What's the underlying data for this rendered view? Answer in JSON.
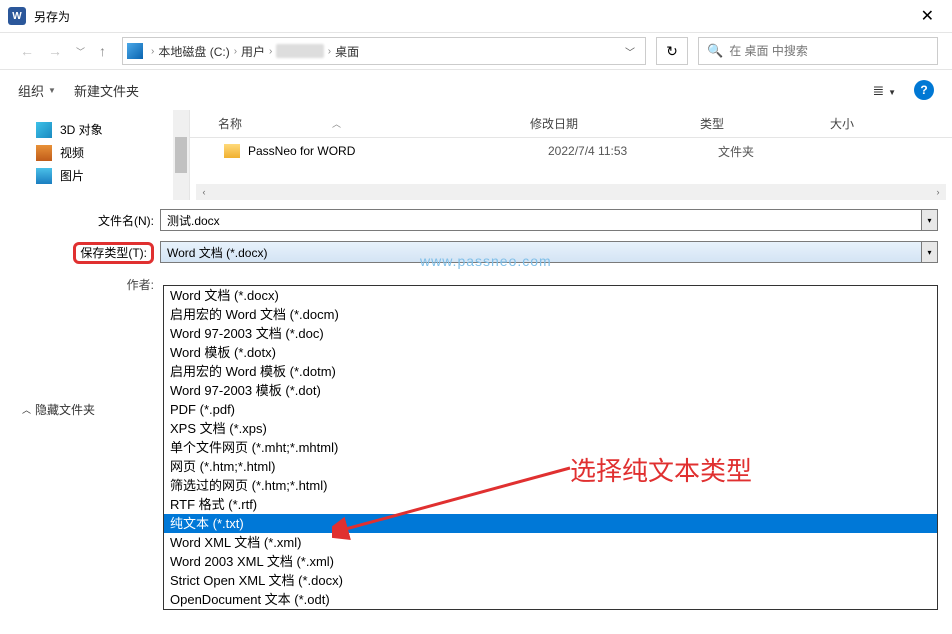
{
  "window": {
    "title": "另存为",
    "app_icon_text": "W"
  },
  "breadcrumb": {
    "items": [
      "本地磁盘 (C:)",
      "用户",
      "",
      "桌面"
    ]
  },
  "search": {
    "placeholder": "在 桌面 中搜索"
  },
  "toolbar": {
    "organize": "组织",
    "new_folder": "新建文件夹"
  },
  "sidebar": {
    "items": [
      {
        "label": "3D 对象"
      },
      {
        "label": "视频"
      },
      {
        "label": "图片"
      }
    ]
  },
  "file_header": {
    "name": "名称",
    "date": "修改日期",
    "type": "类型",
    "size": "大小"
  },
  "files": [
    {
      "name": "PassNeo for WORD",
      "date": "2022/7/4 11:53",
      "type": "文件夹"
    }
  ],
  "form": {
    "filename_label": "文件名(N):",
    "filename_value": "测试.docx",
    "savetype_label": "保存类型(T):",
    "savetype_value": "Word 文档 (*.docx)",
    "author_label": "作者:"
  },
  "hide_folders_label": "隐藏文件夹",
  "watermark": "www.passneo.com",
  "annotation_text": "选择纯文本类型",
  "dropdown_options": [
    "Word 文档 (*.docx)",
    "启用宏的 Word 文档 (*.docm)",
    "Word 97-2003 文档 (*.doc)",
    "Word 模板 (*.dotx)",
    "启用宏的 Word 模板 (*.dotm)",
    "Word 97-2003 模板 (*.dot)",
    "PDF (*.pdf)",
    "XPS 文档 (*.xps)",
    "单个文件网页 (*.mht;*.mhtml)",
    "网页 (*.htm;*.html)",
    "筛选过的网页 (*.htm;*.html)",
    "RTF 格式 (*.rtf)",
    "纯文本 (*.txt)",
    "Word XML 文档 (*.xml)",
    "Word 2003 XML 文档 (*.xml)",
    "Strict Open XML 文档 (*.docx)",
    "OpenDocument 文本 (*.odt)"
  ],
  "dropdown_selected_index": 12
}
